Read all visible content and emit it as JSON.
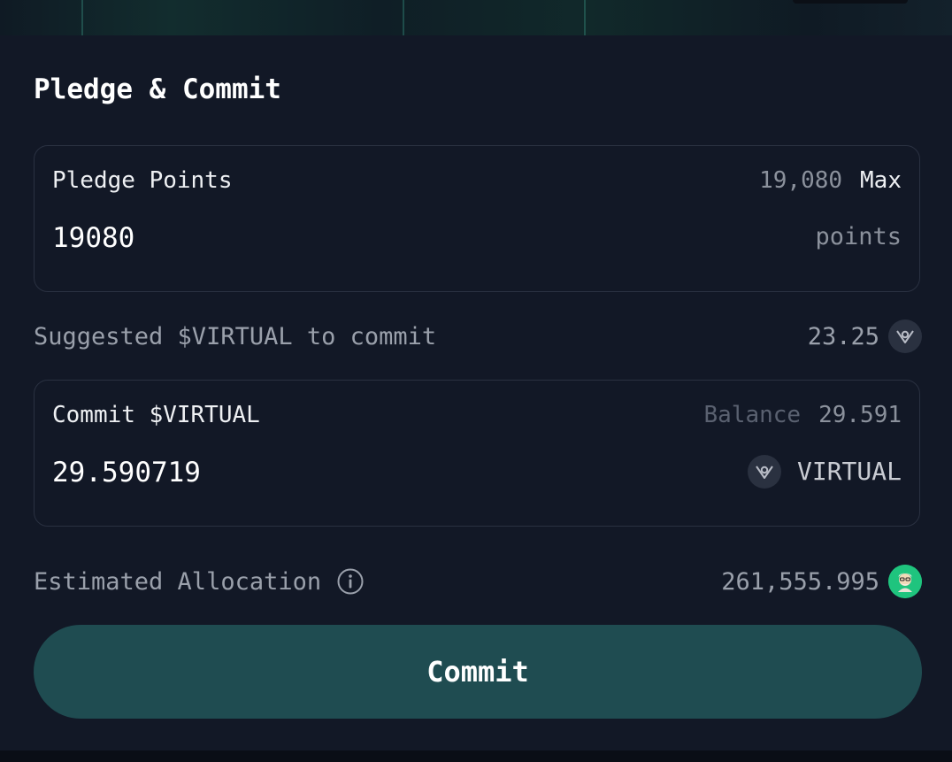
{
  "title": "Pledge & Commit",
  "pledge": {
    "label": "Pledge Points",
    "available": "19,080",
    "max_label": "Max",
    "input_value": "19080",
    "unit": "points"
  },
  "suggested": {
    "label": "Suggested $VIRTUAL to commit",
    "value": "23.25",
    "icon": "virtual-token-icon"
  },
  "commit": {
    "label": "Commit $VIRTUAL",
    "balance_label": "Balance",
    "balance_value": "29.591",
    "input_value": "29.590719",
    "token_symbol": "VIRTUAL",
    "icon": "virtual-token-icon"
  },
  "estimate": {
    "label": "Estimated Allocation",
    "value": "261,555.995",
    "info_icon": "info-icon",
    "avatar_icon": "agent-avatar-icon"
  },
  "button": {
    "label": "Commit"
  },
  "colors": {
    "background": "#121826",
    "card_border": "#2a3141",
    "button": "#1f4c51",
    "avatar": "#1fc47e",
    "muted_text": "#8b919c"
  }
}
